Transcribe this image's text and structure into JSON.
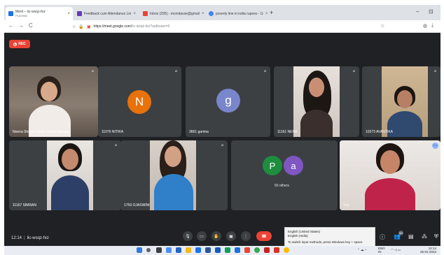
{
  "browser": {
    "tabs": [
      {
        "title": "Meet – lic-wsqz-fez",
        "subtitle": "PLAYING",
        "color": "#1a73e8",
        "active": true
      },
      {
        "title": "Feedback cum Attendance Lin",
        "color": "#673ab7",
        "active": false
      },
      {
        "title": "Inbox (295) - mcmdavse@gmail",
        "color": "#ea4335",
        "active": false
      },
      {
        "title": "poverty line in india rupees - G",
        "color": "#4285f4",
        "active": false
      }
    ],
    "new_tab": "+",
    "window_controls": {
      "minimize": "–",
      "maximize": "⊡"
    },
    "address": {
      "url_host": "https://meet.google.com",
      "url_path": "/lic-wsqz-fez?authuser=0"
    },
    "nav": {
      "back": "←",
      "forward": "→",
      "reload": "C"
    }
  },
  "meet": {
    "recording_label": "REC",
    "tiles": [
      {
        "id": "neena",
        "name": "Neena Sharma Mehr Chand Mahaja",
        "kind": "video"
      },
      {
        "id": "nitika",
        "name": "11076 NITIKA",
        "kind": "avatar",
        "initial": "N",
        "color": "#e8710a"
      },
      {
        "id": "garima",
        "name": "3661 garima",
        "kind": "avatar",
        "initial": "g",
        "color": "#7986cb"
      },
      {
        "id": "neha",
        "name": "11161 NEHA",
        "kind": "video"
      },
      {
        "id": "avantika",
        "name": "10373 AVANTIKA",
        "kind": "video"
      },
      {
        "id": "simran",
        "name": "11167 SIMRAN",
        "kind": "video"
      },
      {
        "id": "ojaswini",
        "name": "1759 OJASWINI",
        "kind": "video"
      },
      {
        "id": "others",
        "name": "50 others",
        "kind": "group",
        "initials": [
          "P",
          "a"
        ],
        "colors": [
          "#1e8e3e",
          "#7e57c2"
        ]
      },
      {
        "id": "you",
        "name": "You",
        "kind": "video"
      }
    ],
    "meeting_time": "12:14",
    "meeting_code": "lic-wsqz-fez",
    "ime_popup": {
      "line1": "English (United States)",
      "line2": "English (India)",
      "line3": "To switch input methods, press Windows key + space."
    },
    "right_controls_badge": "60"
  },
  "taskbar": {
    "tray_lang": "ENG",
    "tray_region": "IN",
    "time": "12:14",
    "date": "25-01-2023"
  }
}
